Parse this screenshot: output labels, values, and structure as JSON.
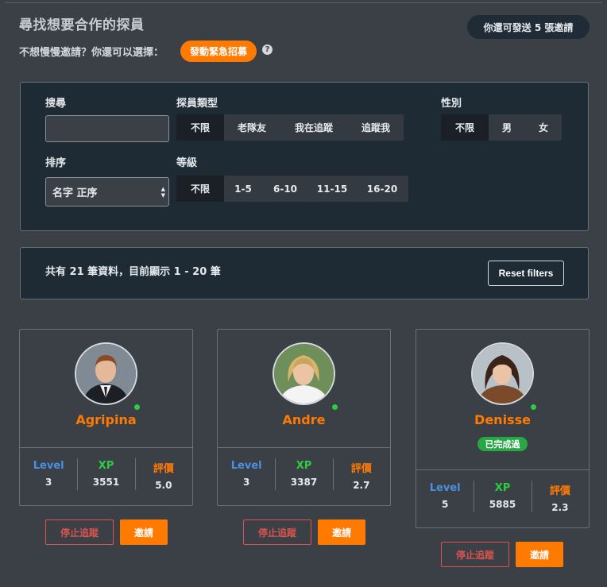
{
  "header": {
    "title": "尋找想要合作的探員",
    "invite_badge": "你還可發送 5 張邀請",
    "subtitle": "不想慢慢邀請？你還可以選擇：",
    "urgent_button": "發動緊急招募",
    "help_icon": "?"
  },
  "filters": {
    "search_label": "搜尋",
    "search_value": "",
    "type_label": "探員類型",
    "type_options": [
      "不限",
      "老隊友",
      "我在追蹤",
      "追蹤我"
    ],
    "type_selected": "不限",
    "gender_label": "性別",
    "gender_options": [
      "不限",
      "男",
      "女"
    ],
    "gender_selected": "不限",
    "sort_label": "排序",
    "sort_value": "名字 正序",
    "level_label": "等級",
    "level_options": [
      "不限",
      "1-5",
      "6-10",
      "11-15",
      "16-20"
    ],
    "level_selected": "不限"
  },
  "results": {
    "summary": "共有 21 筆資料，目前顯示 1 - 20 筆",
    "reset_button": "Reset filters"
  },
  "stat_labels": {
    "level": "Level",
    "xp": "XP",
    "rating": "評價"
  },
  "cards": [
    {
      "name": "Agripina",
      "level": "3",
      "xp": "3551",
      "rating": "5.0",
      "online": true,
      "avatar_icon": "avatar-man-suit"
    },
    {
      "name": "Andre",
      "level": "3",
      "xp": "3387",
      "rating": "2.7",
      "online": true,
      "avatar_icon": "avatar-woman-blonde"
    },
    {
      "name": "Denisse",
      "level": "5",
      "xp": "5885",
      "rating": "2.3",
      "online": true,
      "badge": "已完成過",
      "avatar_icon": "avatar-woman-dark-hair"
    }
  ],
  "card_actions": {
    "unfollow": "停止追蹤",
    "invite": "邀請"
  },
  "colors": {
    "background": "#3b4046",
    "panel": "#1e2b35",
    "accent": "#ff7a00",
    "online": "#2ecc40",
    "level": "#4a90e2",
    "danger": "#d9534f",
    "badge": "#28a745"
  }
}
